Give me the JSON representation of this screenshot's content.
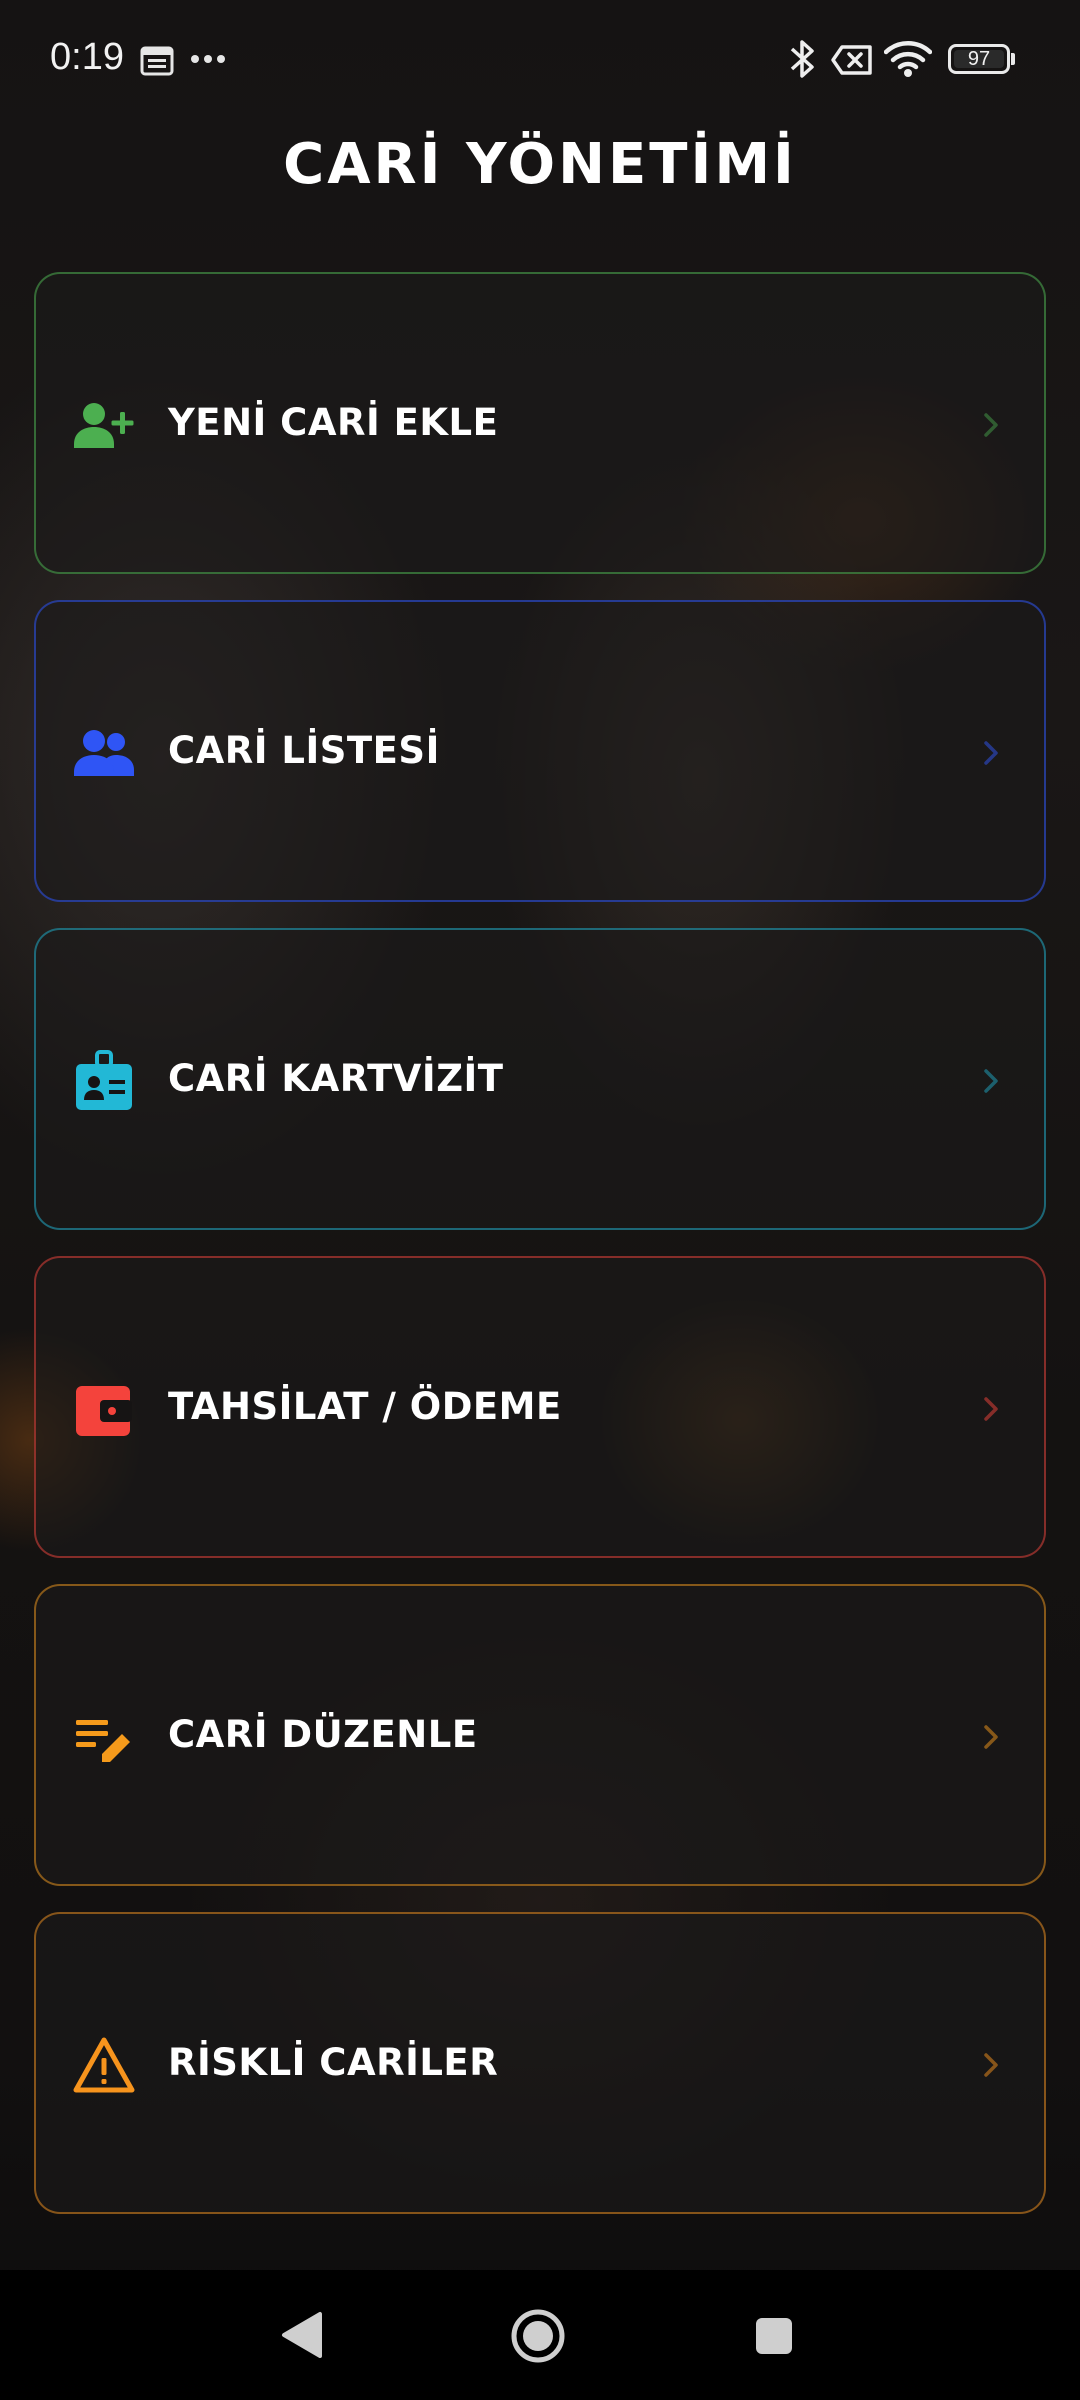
{
  "status_bar": {
    "time": "0:19",
    "left_icons": [
      "calendar-icon",
      "more-dots-icon"
    ],
    "right_icons": [
      "bluetooth-icon",
      "no-sim-icon",
      "wifi-icon",
      "battery-icon"
    ],
    "battery_level": "97"
  },
  "header": {
    "title": "CARİ YÖNETİMİ"
  },
  "menu": [
    {
      "label": "YENİ CARİ EKLE",
      "icon": "person-add-icon",
      "accent": "#4caf50"
    },
    {
      "label": "CARİ LİSTESİ",
      "icon": "people-icon",
      "accent": "#2f55f5"
    },
    {
      "label": "CARİ KARTVİZİT",
      "icon": "badge-icon",
      "accent": "#22b8d6"
    },
    {
      "label": "TAHSİLAT / ÖDEME",
      "icon": "wallet-icon",
      "accent": "#f4433c"
    },
    {
      "label": "CARİ DÜZENLE",
      "icon": "edit-note-icon",
      "accent": "#f59a1b"
    },
    {
      "label": "RİSKLİ CARİLER",
      "icon": "warning-icon",
      "accent": "#f7941d"
    }
  ],
  "nav_bar": {
    "buttons": [
      "back-icon",
      "home-icon",
      "recents-icon"
    ]
  }
}
